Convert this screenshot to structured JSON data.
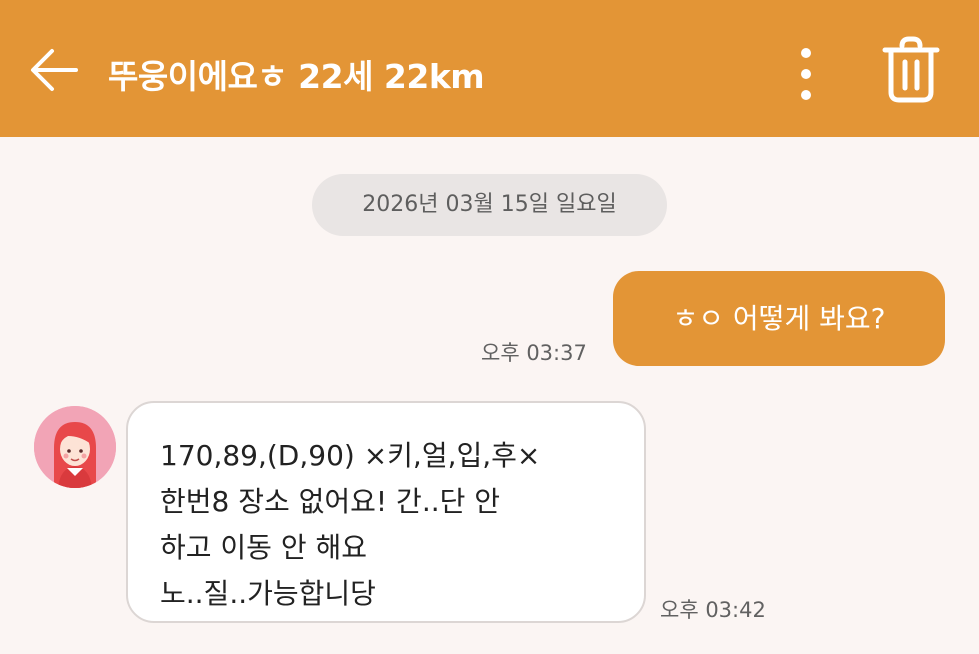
{
  "header": {
    "title": "뚜웅이에요ㅎ 22세 22km",
    "back_icon": "arrow-left-icon",
    "more_icon": "vertical-dots-icon",
    "delete_icon": "trash-icon"
  },
  "chat": {
    "date_separator": "2026년 03월 15일 일요일",
    "messages": [
      {
        "direction": "outgoing",
        "lines": [
          "ㅎㅇ 어떻게 봐요?"
        ],
        "time": "오후 03:37"
      },
      {
        "direction": "incoming",
        "avatar_icon": "profile-avatar-icon",
        "lines": [
          "170,89,(D,90) ×키,얼,입,후×",
          "한번8 장소 없어요! 간..단 안",
          "하고 이동 안 해요",
          "노..질..가능합니당"
        ],
        "time": "오후 03:42"
      }
    ]
  },
  "colors": {
    "accent": "#e39536",
    "background": "#fbf5f3",
    "date_pill": "#e9e5e4",
    "incoming_bubble": "#ffffff"
  }
}
